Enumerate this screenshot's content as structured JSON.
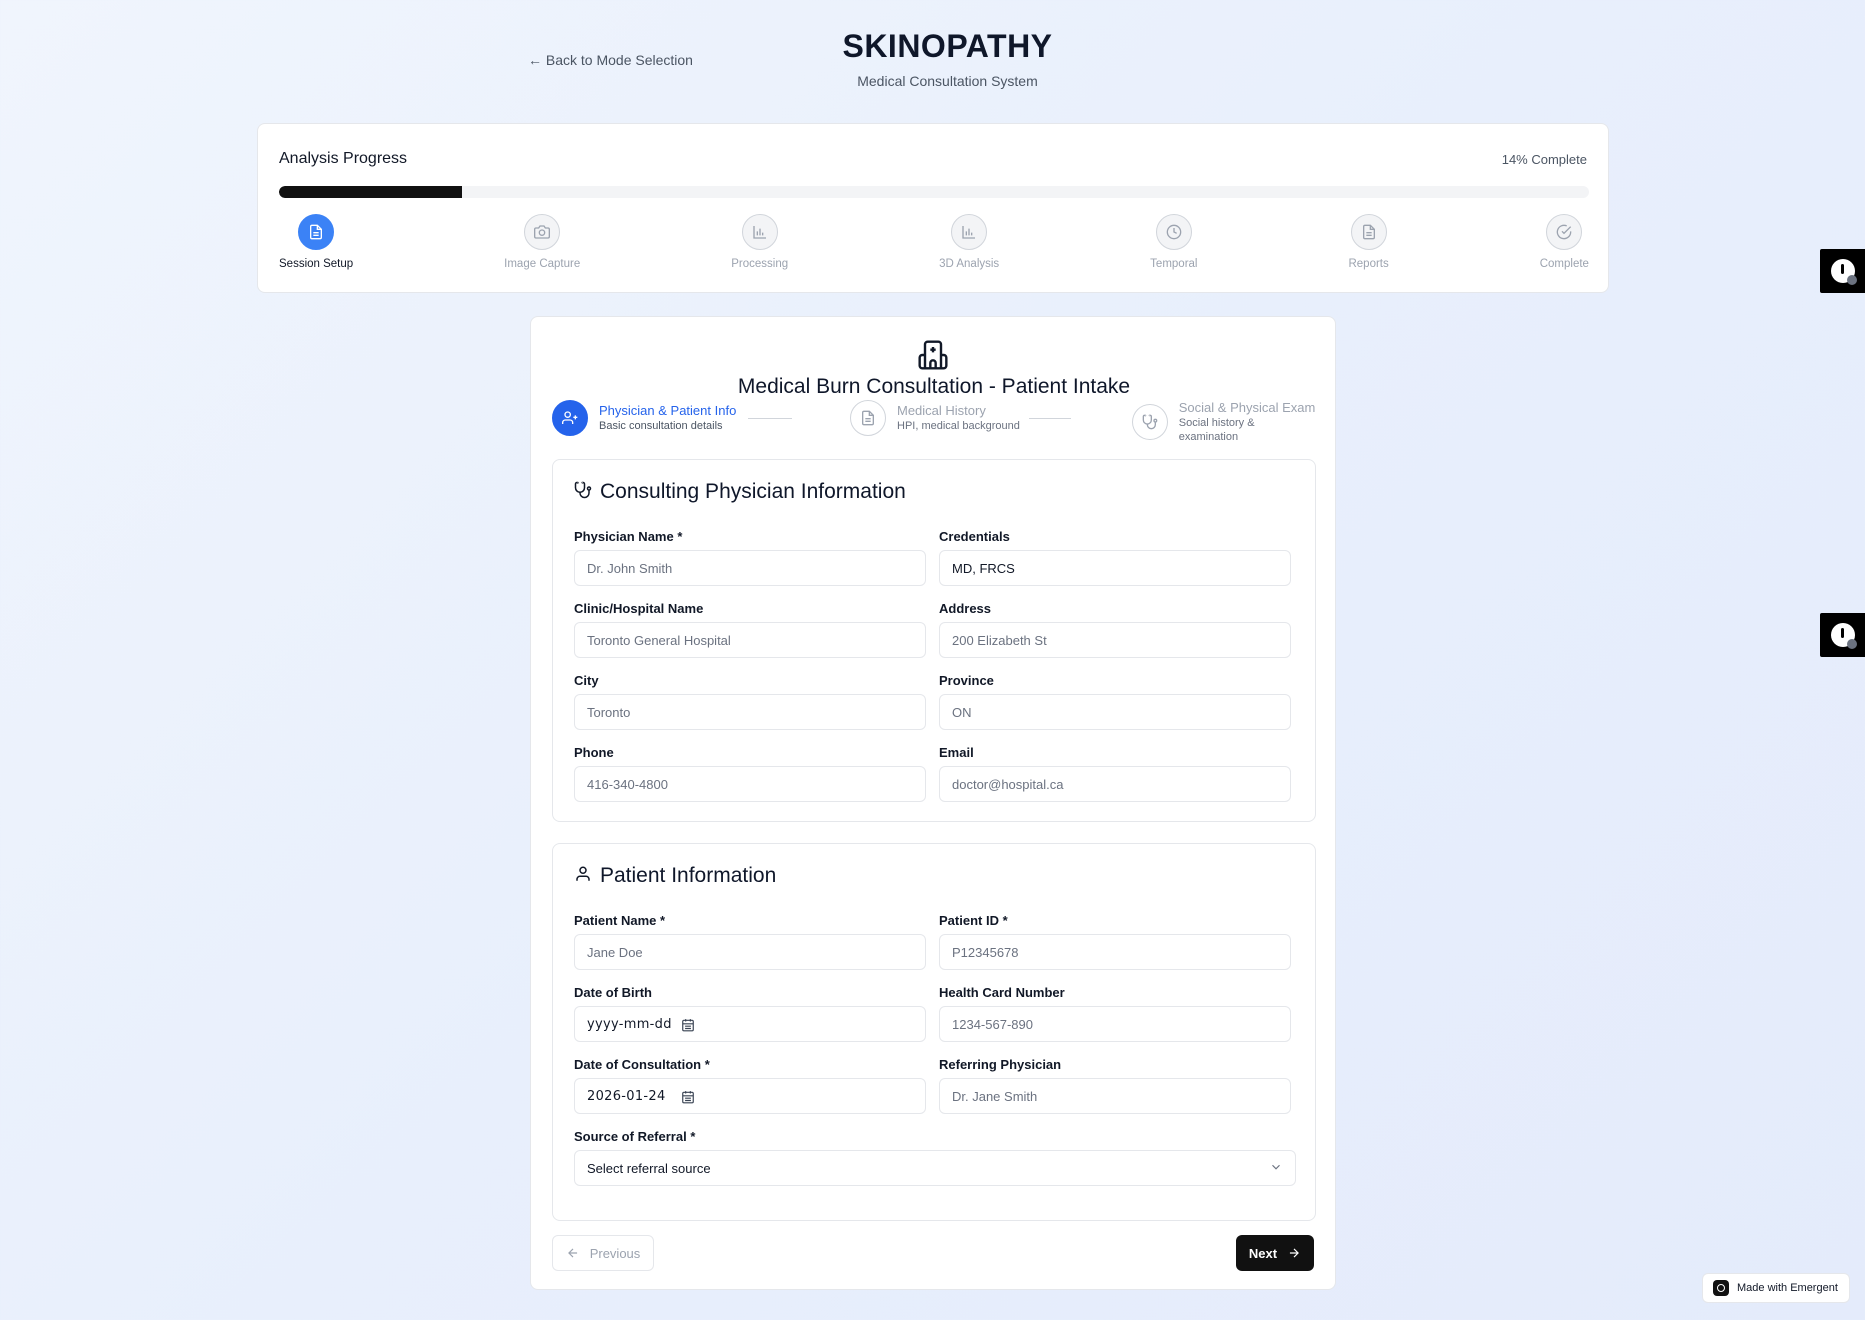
{
  "header": {
    "back_link": "← Back to Mode Selection",
    "brand_title": "SKINOPATHY",
    "brand_subtitle": "Medical Consultation System"
  },
  "progress": {
    "title": "Analysis Progress",
    "percent_label": "14% Complete",
    "percent_value": 14,
    "steps": [
      {
        "label": "Session Setup",
        "icon": "document-icon",
        "active": true
      },
      {
        "label": "Image Capture",
        "icon": "camera-icon",
        "active": false
      },
      {
        "label": "Processing",
        "icon": "bar-chart-icon",
        "active": false
      },
      {
        "label": "3D Analysis",
        "icon": "bar-chart-icon",
        "active": false
      },
      {
        "label": "Temporal",
        "icon": "clock-icon",
        "active": false
      },
      {
        "label": "Reports",
        "icon": "document-icon",
        "active": false
      },
      {
        "label": "Complete",
        "icon": "check-circle-icon",
        "active": false
      }
    ]
  },
  "form": {
    "title": "Medical Burn Consultation - Patient Intake",
    "substeps": [
      {
        "title": "Physician & Patient Info",
        "subtitle": "Basic consultation details"
      },
      {
        "title": "Medical History",
        "subtitle": "HPI, medical background"
      },
      {
        "title": "Social & Physical Exam",
        "subtitle": "Social history & examination"
      }
    ],
    "physician_section": {
      "heading": "Consulting Physician Information",
      "fields": {
        "physician_name": {
          "label": "Physician Name *",
          "placeholder": "Dr. John Smith",
          "value": ""
        },
        "credentials": {
          "label": "Credentials",
          "placeholder": "",
          "value": "MD, FRCS"
        },
        "clinic": {
          "label": "Clinic/Hospital Name",
          "placeholder": "Toronto General Hospital",
          "value": ""
        },
        "address": {
          "label": "Address",
          "placeholder": "200 Elizabeth St",
          "value": ""
        },
        "city": {
          "label": "City",
          "placeholder": "Toronto",
          "value": ""
        },
        "province": {
          "label": "Province",
          "placeholder": "ON",
          "value": ""
        },
        "phone": {
          "label": "Phone",
          "placeholder": "416-340-4800",
          "value": ""
        },
        "email": {
          "label": "Email",
          "placeholder": "doctor@hospital.ca",
          "value": ""
        }
      }
    },
    "patient_section": {
      "heading": "Patient Information",
      "fields": {
        "patient_name": {
          "label": "Patient Name *",
          "placeholder": "Jane Doe",
          "value": ""
        },
        "patient_id": {
          "label": "Patient ID *",
          "placeholder": "P12345678",
          "value": ""
        },
        "dob": {
          "label": "Date of Birth",
          "value": "yyyy-mm-dd"
        },
        "health_card": {
          "label": "Health Card Number",
          "placeholder": "1234-567-890",
          "value": ""
        },
        "consult_date": {
          "label": "Date of Consultation *",
          "value": "2026-01-24"
        },
        "referring": {
          "label": "Referring Physician",
          "placeholder": "Dr. Jane Smith",
          "value": ""
        },
        "referral_source": {
          "label": "Source of Referral *",
          "selected": "Select referral source"
        }
      }
    },
    "buttons": {
      "previous": "Previous",
      "next": "Next"
    }
  },
  "badge": {
    "made_with": "Made with Emergent"
  }
}
